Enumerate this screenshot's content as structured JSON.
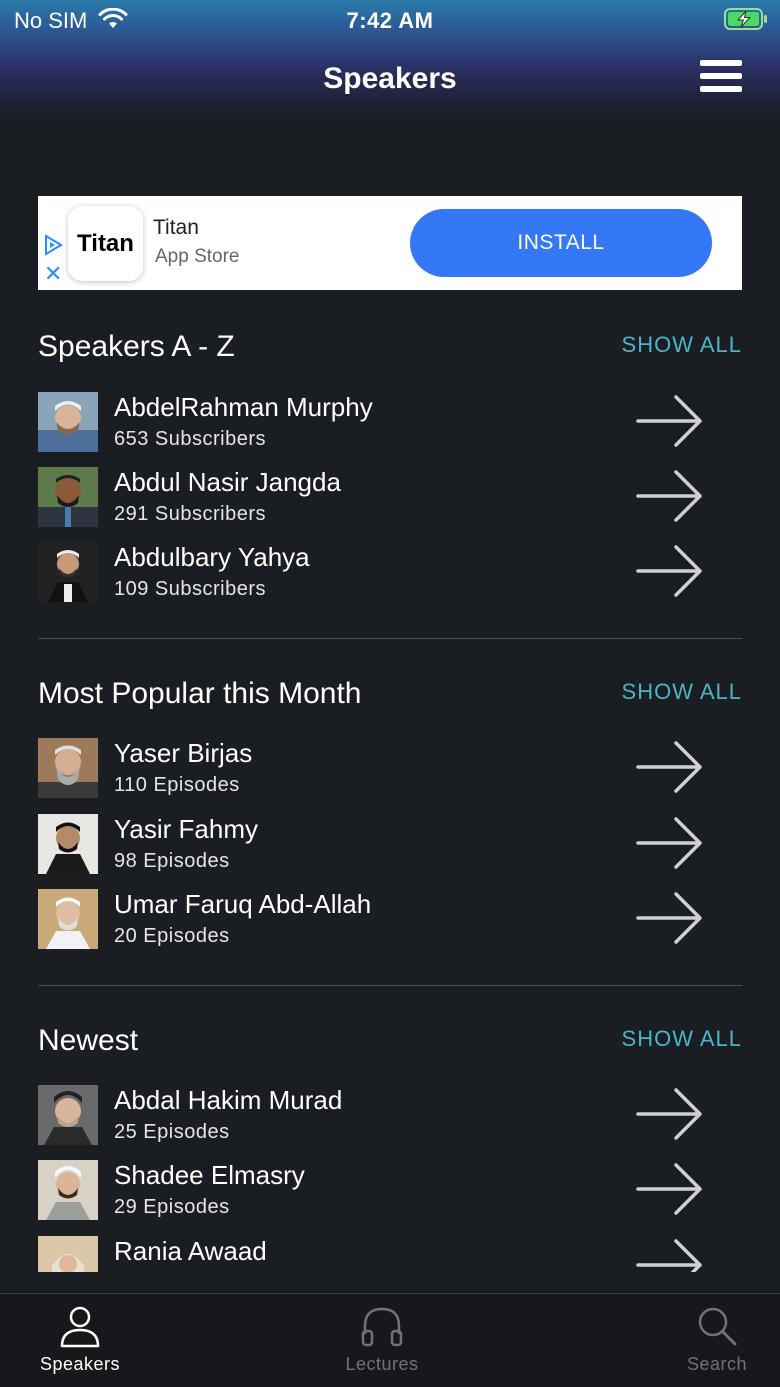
{
  "status_bar": {
    "carrier": "No SIM",
    "time": "7:42 AM"
  },
  "nav": {
    "title": "Speakers"
  },
  "ad": {
    "logo_text": "Titan",
    "title": "Titan",
    "subtitle": "App Store",
    "install_label": "INSTALL",
    "close_glyph": "✕"
  },
  "sections": [
    {
      "title": "Speakers A - Z",
      "show_all": "SHOW ALL",
      "items": [
        {
          "name": "AbdelRahman Murphy",
          "meta": "653 Subscribers"
        },
        {
          "name": "Abdul Nasir Jangda",
          "meta": "291 Subscribers"
        },
        {
          "name": "Abdulbary Yahya",
          "meta": "109 Subscribers"
        }
      ]
    },
    {
      "title": "Most Popular this Month",
      "show_all": "SHOW ALL",
      "items": [
        {
          "name": "Yaser Birjas",
          "meta": "110 Episodes"
        },
        {
          "name": "Yasir Fahmy",
          "meta": "98 Episodes"
        },
        {
          "name": "Umar Faruq Abd-Allah",
          "meta": "20 Episodes"
        }
      ]
    },
    {
      "title": "Newest",
      "show_all": "SHOW ALL",
      "items": [
        {
          "name": "Abdal Hakim Murad",
          "meta": "25 Episodes"
        },
        {
          "name": "Shadee Elmasry",
          "meta": "29 Episodes"
        },
        {
          "name": "Rania Awaad",
          "meta": ""
        }
      ]
    }
  ],
  "tabs": [
    {
      "label": "Speakers",
      "icon": "person-icon",
      "active": true
    },
    {
      "label": "Lectures",
      "icon": "headphones-icon",
      "active": false
    },
    {
      "label": "Search",
      "icon": "search-icon",
      "active": false
    }
  ],
  "colors": {
    "background": "#1a1d21",
    "accent": "#4ab5c9",
    "install_button": "#3478f6",
    "battery_fill": "#4cd964"
  }
}
